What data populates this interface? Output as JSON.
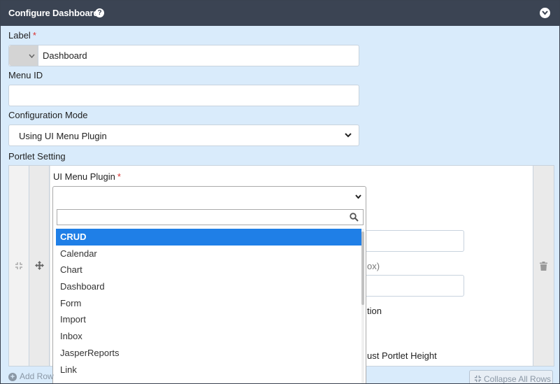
{
  "header": {
    "title": "Configure Dashboard",
    "help_icon": "question-circle-icon",
    "collapse_icon": "chevron-circle-down-icon"
  },
  "form": {
    "label_field": {
      "label": "Label",
      "required_mark": "*",
      "value": "Dashboard",
      "icon_picker": "icon-picker"
    },
    "menu_id_field": {
      "label": "Menu ID",
      "value": ""
    },
    "config_mode_field": {
      "label": "Configuration Mode",
      "value": "Using UI Menu Plugin"
    },
    "portlet_setting": {
      "label": "Portlet Setting"
    }
  },
  "grid": {
    "plugin_field": {
      "label": "UI Menu Plugin",
      "required_mark": "*",
      "value": ""
    },
    "partial_labels": {
      "inbox_suffix": "ox)",
      "position_suffix": "tion",
      "height_suffix": "ust Portlet Height"
    },
    "row_icons": {
      "resize": "compress-icon",
      "move": "move-arrows-icon",
      "delete": "trash-icon"
    }
  },
  "dropdown": {
    "search_placeholder": "",
    "search_icon": "search-icon",
    "selected_index": 0,
    "options": [
      "CRUD",
      "Calendar",
      "Chart",
      "Dashboard",
      "Form",
      "Import",
      "Inbox",
      "JasperReports",
      "Link"
    ]
  },
  "footer": {
    "add_row": "Add Row",
    "collapse_all": "Collapse All Rows"
  },
  "colors": {
    "header_bg": "#3b4453",
    "panel_bg": "#d9ebfb",
    "highlight": "#1f7fe7",
    "required": "#d9312f"
  }
}
